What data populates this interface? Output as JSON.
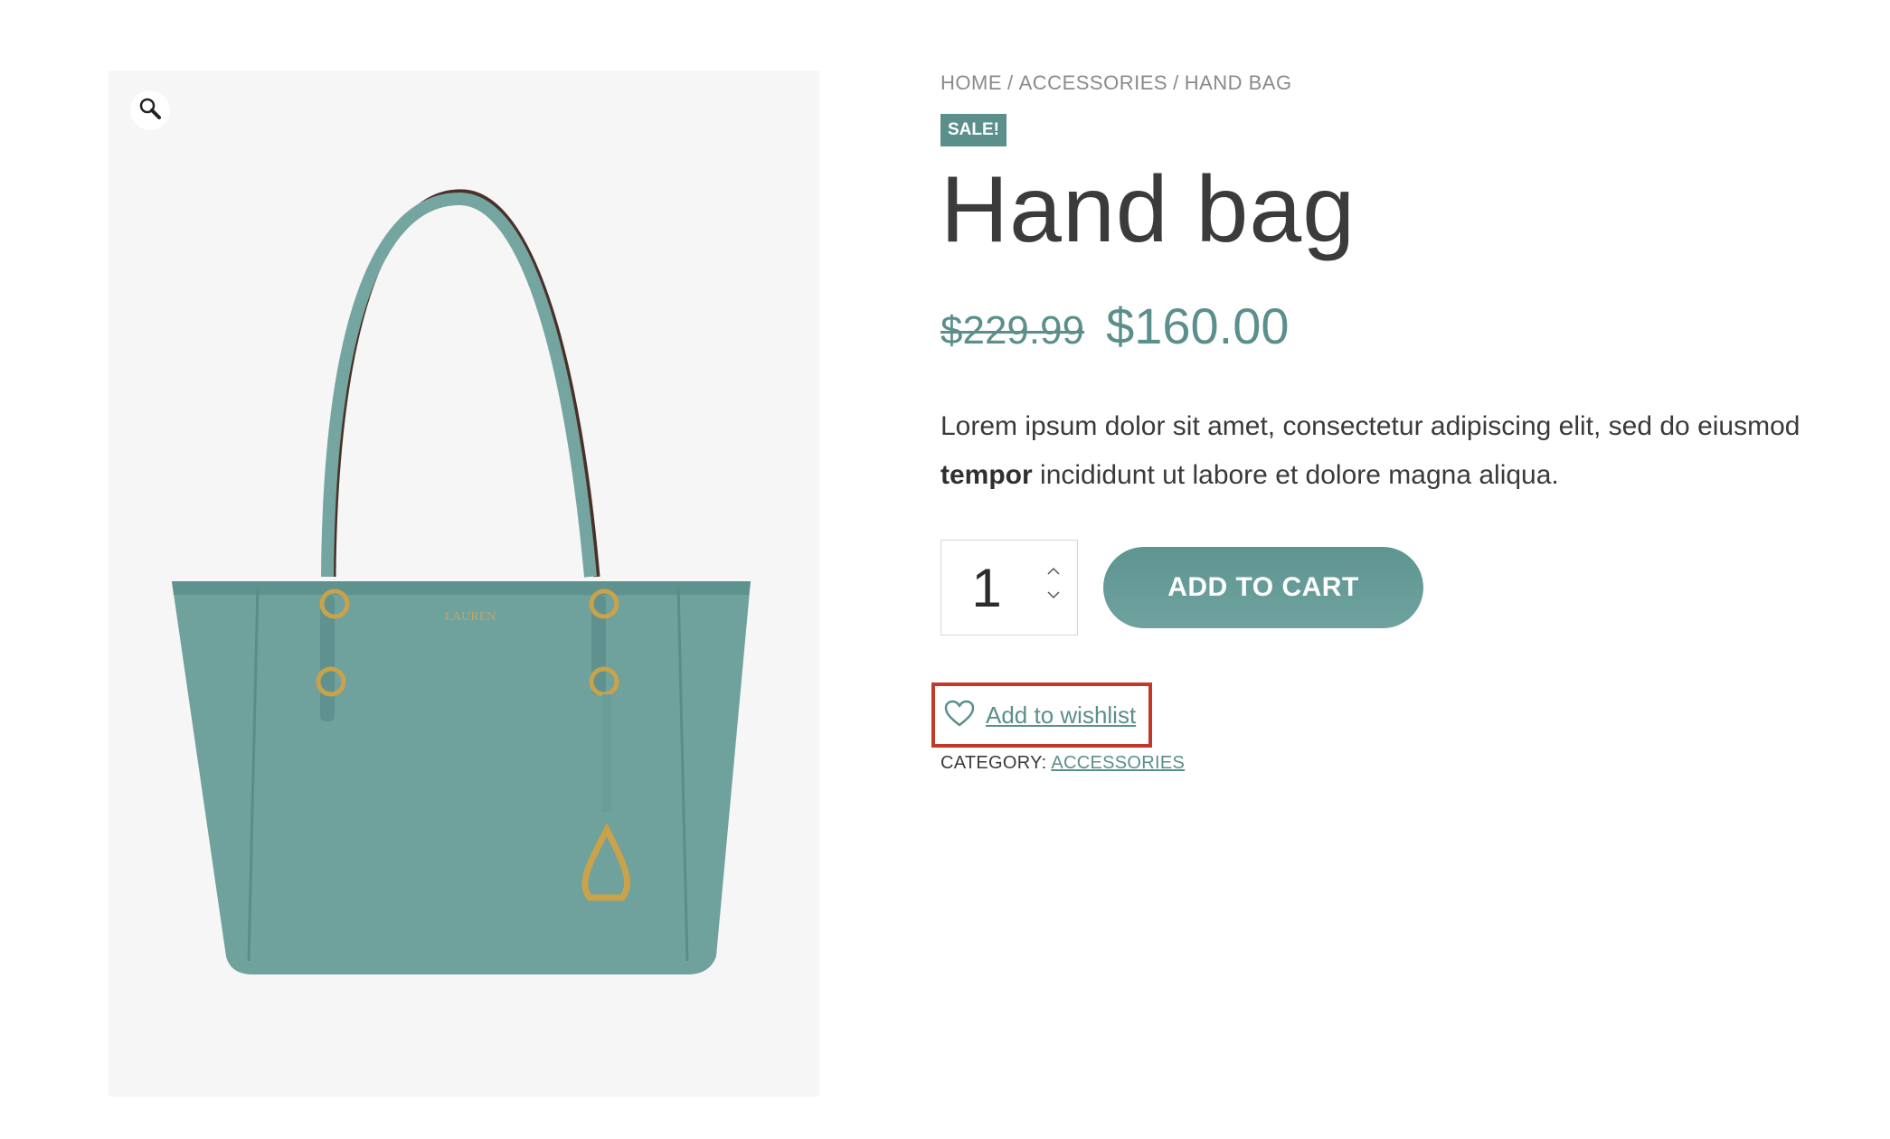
{
  "breadcrumb": {
    "items": [
      "HOME",
      "ACCESSORIES",
      "HAND BAG"
    ],
    "separator": "/"
  },
  "product": {
    "sale_badge": "SALE!",
    "title": "Hand bag",
    "old_price": "$229.99",
    "new_price": "$160.00",
    "description_part1": "Lorem ipsum dolor sit amet, consectetur adipiscing elit, sed do eiusmod ",
    "description_bold": "tempor",
    "description_part2": " incididunt ut labore et dolore magna aliqua.",
    "quantity": "1",
    "add_to_cart_label": "ADD TO CART",
    "wishlist_label": "Add to wishlist",
    "category_label": "CATEGORY:",
    "category_value": "ACCESSORIES"
  },
  "icons": {
    "zoom": "magnifier-icon",
    "wishlist": "heart-outline-icon",
    "qty_up": "chevron-up-icon",
    "qty_down": "chevron-down-icon"
  },
  "colors": {
    "accent": "#5b8f8b",
    "highlight_border": "#c2392b",
    "gallery_bg": "#f6f6f6",
    "bag": "#6fa19d"
  }
}
